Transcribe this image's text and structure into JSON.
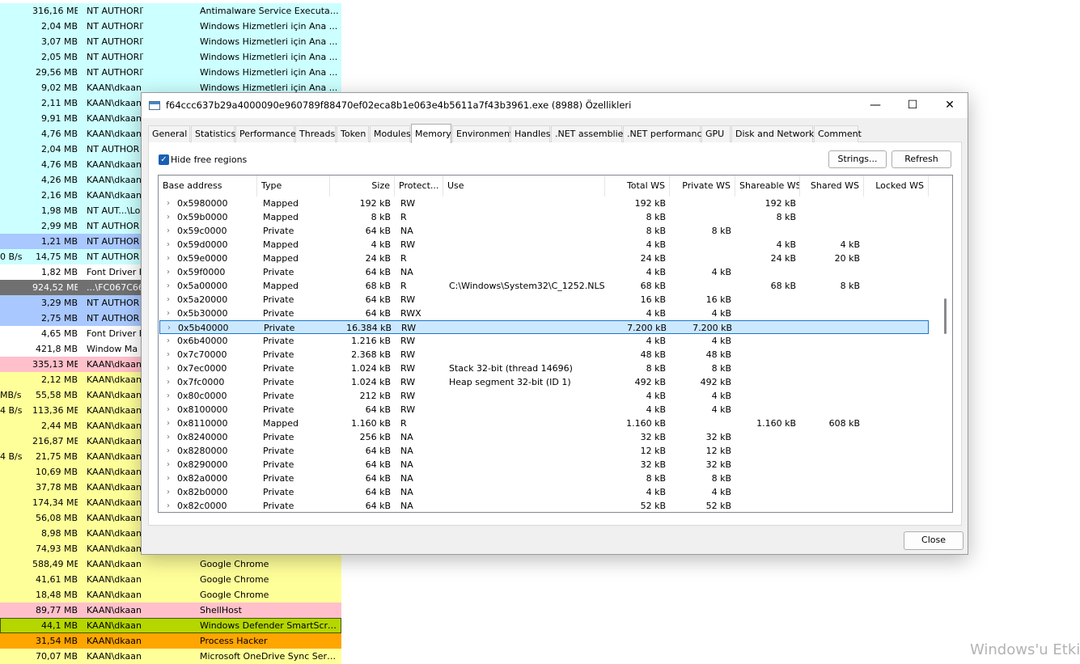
{
  "background": {
    "rows": [
      {
        "io": "",
        "mem": "316,16 MB",
        "user": "NT AUTHORITY\\SYSTEM",
        "desc": "Antimalware Service Executable",
        "color": "#ccffff"
      },
      {
        "io": "",
        "mem": "2,04 MB",
        "user": "NT AUTHORITY\\SYSTEM",
        "desc": "Windows Hizmetleri için Ana ...",
        "color": "#ccffff"
      },
      {
        "io": "",
        "mem": "3,07 MB",
        "user": "NT AUTHORITY\\SYSTEM",
        "desc": "Windows Hizmetleri için Ana ...",
        "color": "#ccffff"
      },
      {
        "io": "",
        "mem": "2,05 MB",
        "user": "NT AUTHORITY\\SYSTEM",
        "desc": "Windows Hizmetleri için Ana ...",
        "color": "#ccffff"
      },
      {
        "io": "",
        "mem": "29,56 MB",
        "user": "NT AUTHORITY\\SYSTEM",
        "desc": "Windows Hizmetleri için Ana ...",
        "color": "#ccffff"
      },
      {
        "io": "",
        "mem": "9,02 MB",
        "user": "KAAN\\dkaan",
        "desc": "Windows Hizmetleri için Ana ...",
        "color": "#ccffff"
      },
      {
        "io": "",
        "mem": "2,11 MB",
        "user": "KAAN\\dkaan",
        "desc": "",
        "color": "#ccffff"
      },
      {
        "io": "",
        "mem": "9,91 MB",
        "user": "KAAN\\dkaan",
        "desc": "",
        "color": "#ccffff"
      },
      {
        "io": "",
        "mem": "4,76 MB",
        "user": "KAAN\\dkaan",
        "desc": "",
        "color": "#ccffff"
      },
      {
        "io": "",
        "mem": "2,04 MB",
        "user": "NT AUTHOR",
        "desc": "",
        "color": "#ccffff"
      },
      {
        "io": "",
        "mem": "4,76 MB",
        "user": "KAAN\\dkaan",
        "desc": "",
        "color": "#ccffff"
      },
      {
        "io": "",
        "mem": "4,26 MB",
        "user": "KAAN\\dkaan",
        "desc": "",
        "color": "#ccffff"
      },
      {
        "io": "",
        "mem": "2,16 MB",
        "user": "KAAN\\dkaan",
        "desc": "",
        "color": "#ccffff"
      },
      {
        "io": "",
        "mem": "1,98 MB",
        "user": "NT AUT...\\Lo",
        "desc": "",
        "color": "#ccffff"
      },
      {
        "io": "",
        "mem": "2,99 MB",
        "user": "NT AUTHOR",
        "desc": "",
        "color": "#ccffff"
      },
      {
        "io": "",
        "mem": "1,21 MB",
        "user": "NT AUTHOR",
        "desc": "",
        "color": "#a8c8ff"
      },
      {
        "io": "0 B/s",
        "mem": "14,75 MB",
        "user": "NT AUTHOR",
        "desc": "",
        "color": "#ccffff"
      },
      {
        "io": "",
        "mem": "1,82 MB",
        "user": "Font Driver H",
        "desc": "",
        "color": "#ffffff"
      },
      {
        "io": "",
        "mem": "924,52 MB",
        "user": "...\\FC067C66",
        "desc": "",
        "color": "#707070",
        "text": "#ffffff"
      },
      {
        "io": "",
        "mem": "3,29 MB",
        "user": "NT AUTHOR",
        "desc": "",
        "color": "#a8c8ff"
      },
      {
        "io": "",
        "mem": "2,75 MB",
        "user": "NT AUTHOR",
        "desc": "",
        "color": "#a8c8ff"
      },
      {
        "io": "",
        "mem": "4,65 MB",
        "user": "Font Driver H",
        "desc": "",
        "color": "#ffffff"
      },
      {
        "io": "",
        "mem": "421,8 MB",
        "user": "Window Ma",
        "desc": "",
        "color": "#ffffff"
      },
      {
        "io": "",
        "mem": "335,13 MB",
        "user": "KAAN\\dkaan",
        "desc": "",
        "color": "#ffc0cb"
      },
      {
        "io": "",
        "mem": "2,12 MB",
        "user": "KAAN\\dkaan",
        "desc": "",
        "color": "#ffff99"
      },
      {
        "io": "MB/s",
        "mem": "55,58 MB",
        "user": "KAAN\\dkaan",
        "desc": "",
        "color": "#ffff99"
      },
      {
        "io": "4 B/s",
        "mem": "113,36 MB",
        "user": "KAAN\\dkaan",
        "desc": "",
        "color": "#ffff99"
      },
      {
        "io": "",
        "mem": "2,44 MB",
        "user": "KAAN\\dkaan",
        "desc": "",
        "color": "#ffff99"
      },
      {
        "io": "",
        "mem": "216,87 MB",
        "user": "KAAN\\dkaan",
        "desc": "",
        "color": "#ffff99"
      },
      {
        "io": "4 B/s",
        "mem": "21,75 MB",
        "user": "KAAN\\dkaan",
        "desc": "",
        "color": "#ffff99"
      },
      {
        "io": "",
        "mem": "10,69 MB",
        "user": "KAAN\\dkaan",
        "desc": "",
        "color": "#ffff99"
      },
      {
        "io": "",
        "mem": "37,78 MB",
        "user": "KAAN\\dkaan",
        "desc": "",
        "color": "#ffff99"
      },
      {
        "io": "",
        "mem": "174,34 MB",
        "user": "KAAN\\dkaan",
        "desc": "",
        "color": "#ffff99"
      },
      {
        "io": "",
        "mem": "56,08 MB",
        "user": "KAAN\\dkaan",
        "desc": "",
        "color": "#ffff99"
      },
      {
        "io": "",
        "mem": "8,98 MB",
        "user": "KAAN\\dkaan",
        "desc": "",
        "color": "#ffff99"
      },
      {
        "io": "",
        "mem": "74,93 MB",
        "user": "KAAN\\dkaan",
        "desc": "",
        "color": "#ffff99"
      },
      {
        "io": "",
        "mem": "588,49 MB",
        "user": "KAAN\\dkaan",
        "desc": "Google Chrome",
        "color": "#ffff99"
      },
      {
        "io": "",
        "mem": "41,61 MB",
        "user": "KAAN\\dkaan",
        "desc": "Google Chrome",
        "color": "#ffff99"
      },
      {
        "io": "",
        "mem": "18,48 MB",
        "user": "KAAN\\dkaan",
        "desc": "Google Chrome",
        "color": "#ffff99"
      },
      {
        "io": "",
        "mem": "89,77 MB",
        "user": "KAAN\\dkaan",
        "desc": "ShellHost",
        "color": "#ffc0cb"
      },
      {
        "io": "",
        "mem": "44,1 MB",
        "user": "KAAN\\dkaan",
        "desc": "Windows Defender SmartScre...",
        "color": "#b6d600",
        "outline": true
      },
      {
        "io": "",
        "mem": "31,54 MB",
        "user": "KAAN\\dkaan",
        "desc": "Process Hacker",
        "color": "#ffa500"
      },
      {
        "io": "",
        "mem": "70,07 MB",
        "user": "KAAN\\dkaan",
        "desc": "Microsoft OneDrive Sync Servi...",
        "color": "#ffff99"
      }
    ]
  },
  "watermark": "Windows'u Etki",
  "dialog": {
    "title": "f64ccc637b29a4000090e960789f88470ef02eca8b1e063e4b5611a7f43b3961.exe (8988) Özellikleri",
    "minimize_glyph": "—",
    "maximize_glyph": "☐",
    "close_glyph": "✕",
    "tabs": [
      "General",
      "Statistics",
      "Performance",
      "Threads",
      "Token",
      "Modules",
      "Memory",
      "Environment",
      "Handles",
      ".NET assemblies",
      ".NET performance",
      "GPU",
      "Disk and Network",
      "Comment"
    ],
    "active_tab": "Memory",
    "hide_free_label": "Hide free regions",
    "hide_free_checked": true,
    "check_glyph": "✓",
    "strings_label": "Strings...",
    "refresh_label": "Refresh",
    "close_label": "Close",
    "expand_glyph": "›",
    "columns": [
      "Base address",
      "Type",
      "Size",
      "Protect...",
      "Use",
      "Total WS",
      "Private WS",
      "Shareable WS",
      "Shared WS",
      "Locked WS"
    ],
    "rows": [
      [
        "0x5980000",
        "Mapped",
        "192 kB",
        "RW",
        "",
        "192 kB",
        "",
        "192 kB",
        "",
        ""
      ],
      [
        "0x59b0000",
        "Mapped",
        "8 kB",
        "R",
        "",
        "8 kB",
        "",
        "8 kB",
        "",
        ""
      ],
      [
        "0x59c0000",
        "Private",
        "64 kB",
        "NA",
        "",
        "8 kB",
        "8 kB",
        "",
        "",
        ""
      ],
      [
        "0x59d0000",
        "Mapped",
        "4 kB",
        "RW",
        "",
        "4 kB",
        "",
        "4 kB",
        "4 kB",
        ""
      ],
      [
        "0x59e0000",
        "Mapped",
        "24 kB",
        "R",
        "",
        "24 kB",
        "",
        "24 kB",
        "20 kB",
        ""
      ],
      [
        "0x59f0000",
        "Private",
        "64 kB",
        "NA",
        "",
        "4 kB",
        "4 kB",
        "",
        "",
        ""
      ],
      [
        "0x5a00000",
        "Mapped",
        "68 kB",
        "R",
        "C:\\Windows\\System32\\C_1252.NLS",
        "68 kB",
        "",
        "68 kB",
        "8 kB",
        ""
      ],
      [
        "0x5a20000",
        "Private",
        "64 kB",
        "RW",
        "",
        "16 kB",
        "16 kB",
        "",
        "",
        ""
      ],
      [
        "0x5b30000",
        "Private",
        "64 kB",
        "RWX",
        "",
        "4 kB",
        "4 kB",
        "",
        "",
        ""
      ],
      [
        "0x5b40000",
        "Private",
        "16.384 kB",
        "RW",
        "",
        "7.200 kB",
        "7.200 kB",
        "",
        "",
        ""
      ],
      [
        "0x6b40000",
        "Private",
        "1.216 kB",
        "RW",
        "",
        "4 kB",
        "4 kB",
        "",
        "",
        ""
      ],
      [
        "0x7c70000",
        "Private",
        "2.368 kB",
        "RW",
        "",
        "48 kB",
        "48 kB",
        "",
        "",
        ""
      ],
      [
        "0x7ec0000",
        "Private",
        "1.024 kB",
        "RW",
        "Stack 32-bit (thread 14696)",
        "8 kB",
        "8 kB",
        "",
        "",
        ""
      ],
      [
        "0x7fc0000",
        "Private",
        "1.024 kB",
        "RW",
        "Heap segment 32-bit (ID 1)",
        "492 kB",
        "492 kB",
        "",
        "",
        ""
      ],
      [
        "0x80c0000",
        "Private",
        "212 kB",
        "RW",
        "",
        "4 kB",
        "4 kB",
        "",
        "",
        ""
      ],
      [
        "0x8100000",
        "Private",
        "64 kB",
        "RW",
        "",
        "4 kB",
        "4 kB",
        "",
        "",
        ""
      ],
      [
        "0x8110000",
        "Mapped",
        "1.160 kB",
        "R",
        "",
        "1.160 kB",
        "",
        "1.160 kB",
        "608 kB",
        ""
      ],
      [
        "0x8240000",
        "Private",
        "256 kB",
        "NA",
        "",
        "32 kB",
        "32 kB",
        "",
        "",
        ""
      ],
      [
        "0x8280000",
        "Private",
        "64 kB",
        "NA",
        "",
        "12 kB",
        "12 kB",
        "",
        "",
        ""
      ],
      [
        "0x8290000",
        "Private",
        "64 kB",
        "NA",
        "",
        "32 kB",
        "32 kB",
        "",
        "",
        ""
      ],
      [
        "0x82a0000",
        "Private",
        "64 kB",
        "NA",
        "",
        "8 kB",
        "8 kB",
        "",
        "",
        ""
      ],
      [
        "0x82b0000",
        "Private",
        "64 kB",
        "NA",
        "",
        "4 kB",
        "4 kB",
        "",
        "",
        ""
      ],
      [
        "0x82c0000",
        "Private",
        "64 kB",
        "NA",
        "",
        "52 kB",
        "52 kB",
        "",
        "",
        ""
      ]
    ],
    "selected_row": 9
  }
}
